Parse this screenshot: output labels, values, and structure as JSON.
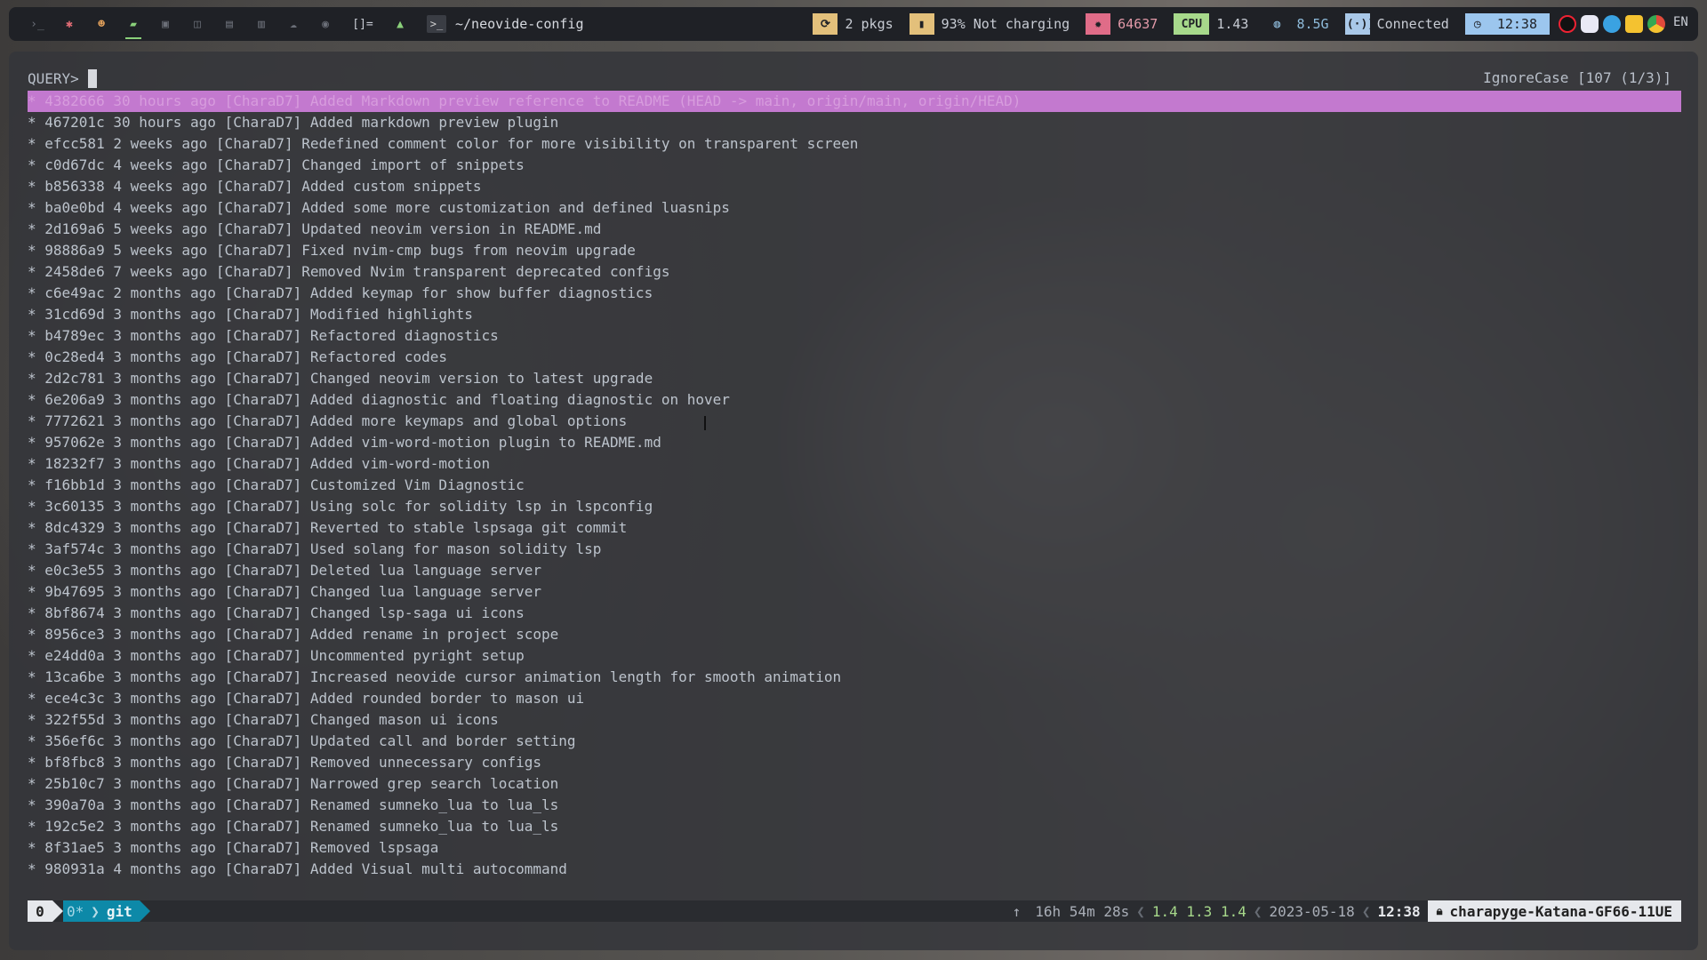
{
  "topbar": {
    "window_title": "~/neovide-config",
    "workspaces": [
      "›_",
      "✱",
      "☻",
      "▰",
      "▣",
      "◫",
      "▤",
      "▥",
      "☁",
      "◉",
      "[]="
    ],
    "pkgs": "2 pkgs",
    "battery": "93% Not charging",
    "temp": "64637",
    "cpu_label": "CPU",
    "cpu_value": "1.43",
    "mem": "8.5G",
    "network": "Connected",
    "clock": "12:38",
    "lang": "EN"
  },
  "terminal": {
    "query_label": "QUERY>",
    "status": "IgnoreCase [107 (1/3)]",
    "lines": [
      "* 4382666 30 hours ago [CharaD7] Added Markdown preview reference to README (HEAD -> main, origin/main, origin/HEAD)",
      "* 467201c 30 hours ago [CharaD7] Added markdown preview plugin",
      "* efcc581 2 weeks ago [CharaD7] Redefined comment color for more visibility on transparent screen",
      "* c0d67dc 4 weeks ago [CharaD7] Changed import of snippets",
      "* b856338 4 weeks ago [CharaD7] Added custom snippets",
      "* ba0e0bd 4 weeks ago [CharaD7] Added some more customization and defined luasnips",
      "* 2d169a6 5 weeks ago [CharaD7] Updated neovim version in README.md",
      "* 98886a9 5 weeks ago [CharaD7] Fixed nvim-cmp bugs from neovim upgrade",
      "* 2458de6 7 weeks ago [CharaD7] Removed Nvim transparent deprecated configs",
      "* c6e49ac 2 months ago [CharaD7] Added keymap for show buffer diagnostics",
      "* 31cd69d 3 months ago [CharaD7] Modified highlights",
      "* b4789ec 3 months ago [CharaD7] Refactored diagnostics",
      "* 0c28ed4 3 months ago [CharaD7] Refactored codes",
      "* 2d2c781 3 months ago [CharaD7] Changed neovim version to latest upgrade",
      "* 6e206a9 3 months ago [CharaD7] Added diagnostic and floating diagnostic on hover",
      "* 7772621 3 months ago [CharaD7] Added more keymaps and global options",
      "* 957062e 3 months ago [CharaD7] Added vim-word-motion plugin to README.md",
      "* 18232f7 3 months ago [CharaD7] Added vim-word-motion",
      "* f16bb1d 3 months ago [CharaD7] Customized Vim Diagnostic",
      "* 3c60135 3 months ago [CharaD7] Using solc for solidity lsp in lspconfig",
      "* 8dc4329 3 months ago [CharaD7] Reverted to stable lspsaga git commit",
      "* 3af574c 3 months ago [CharaD7] Used solang for mason solidity lsp",
      "* e0c3e55 3 months ago [CharaD7] Deleted lua language server",
      "* 9b47695 3 months ago [CharaD7] Changed lua language server",
      "* 8bf8674 3 months ago [CharaD7] Changed lsp-saga ui icons",
      "* 8956ce3 3 months ago [CharaD7] Added rename in project scope",
      "* e24dd0a 3 months ago [CharaD7] Uncommented pyright setup",
      "* 13ca6be 3 months ago [CharaD7] Increased neovide cursor animation length for smooth animation",
      "* ece4c3c 3 months ago [CharaD7] Added rounded border to mason ui",
      "* 322f55d 3 months ago [CharaD7] Changed mason ui icons",
      "* 356ef6c 3 months ago [CharaD7] Updated call and border setting",
      "* bf8fbc8 3 months ago [CharaD7] Removed unnecessary configs",
      "* 25b10c7 3 months ago [CharaD7] Narrowed grep search location",
      "* 390a70a 3 months ago [CharaD7] Renamed sumneko_lua to lua_ls",
      "* 192c5e2 3 months ago [CharaD7] Renamed sumneko_lua to lua_ls",
      "* 8f31ae5 3 months ago [CharaD7] Removed lspsaga",
      "* 980931a 4 months ago [CharaD7] Added Visual multi autocommand"
    ]
  },
  "tmux": {
    "session": "0",
    "window_index": "0*",
    "window_name": "git",
    "uptime": "16h 54m 28s",
    "load": "1.4 1.3 1.4",
    "date": "2023-05-18",
    "time": "12:38",
    "host": "charapyge-Katana-GF66-11UE"
  }
}
